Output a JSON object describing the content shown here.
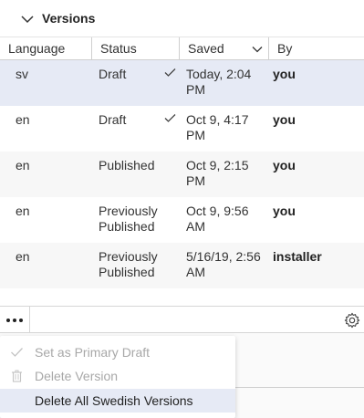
{
  "panel": {
    "title": "Versions"
  },
  "columns": {
    "language": "Language",
    "status": "Status",
    "saved": "Saved",
    "by": "By"
  },
  "rows": [
    {
      "language": "sv",
      "status_line1": "Draft",
      "status_line2": "",
      "saved_line1": "Today, 2:04",
      "saved_line2": "PM",
      "by": "you",
      "checked": true,
      "selected": true
    },
    {
      "language": "en",
      "status_line1": "Draft",
      "status_line2": "",
      "saved_line1": "Oct 9, 4:17",
      "saved_line2": "PM",
      "by": "you",
      "checked": true,
      "selected": false
    },
    {
      "language": "en",
      "status_line1": "Published",
      "status_line2": "",
      "saved_line1": "Oct 9, 2:15",
      "saved_line2": "PM",
      "by": "you",
      "checked": false,
      "selected": false
    },
    {
      "language": "en",
      "status_line1": "Previously",
      "status_line2": "Published",
      "saved_line1": "Oct 9, 9:56",
      "saved_line2": "AM",
      "by": "you",
      "checked": false,
      "selected": false
    },
    {
      "language": "en",
      "status_line1": "Previously",
      "status_line2": "Published",
      "saved_line1": "5/16/19, 2:56",
      "saved_line2": "AM",
      "by": "installer",
      "checked": false,
      "selected": false
    }
  ],
  "menu": {
    "items": [
      {
        "label": "Set as Primary Draft",
        "icon": "check-icon",
        "disabled": true
      },
      {
        "label": "Delete Version",
        "icon": "trash-icon",
        "disabled": true
      },
      {
        "label": "Delete All Swedish Versions",
        "icon": "",
        "disabled": false
      }
    ]
  },
  "colors": {
    "selected_row": "#e6eaf5",
    "disabled_text": "#a8a8a8"
  }
}
